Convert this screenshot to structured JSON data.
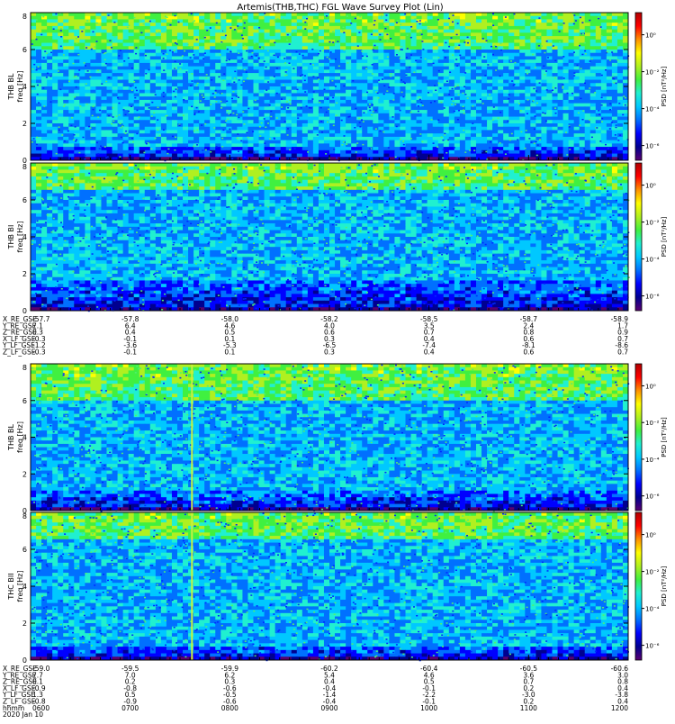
{
  "title": "Artemis(THB,THC) FGL Wave Survey Plot (Lin)",
  "chart_data": {
    "type": "heatmap",
    "title": "Artemis(THB,THC) FGL Wave Survey Plot (Lin)",
    "colormap": [
      "#5a0070",
      "#000090",
      "#0000ff",
      "#0070ff",
      "#00c8ff",
      "#20f0d0",
      "#40f040",
      "#b0f020",
      "#ffff00",
      "#ff9000",
      "#ff0000",
      "#b00000"
    ],
    "panels": [
      {
        "id": "p1",
        "ylabel_top": "THB BL",
        "ylabel": "freq [Hz]",
        "ylim": [
          0,
          8
        ],
        "yticks": [
          "0",
          "2",
          "4",
          "6",
          "8"
        ],
        "cbar_label": "PSD [nT²/Hz]",
        "cbar_ticks": [
          "10⁰",
          "10⁻²",
          "10⁻⁴",
          "10⁻⁶"
        ],
        "bright_band_hz": [
          6.0,
          8.0
        ],
        "noise_floor_hz": [
          0.0,
          0.8
        ],
        "spike_x_frac": null
      },
      {
        "id": "p2",
        "ylabel_top": "THB BI",
        "ylabel": "freq [Hz]",
        "ylim": [
          0,
          8
        ],
        "yticks": [
          "0",
          "2",
          "4",
          "6",
          "8"
        ],
        "cbar_label": "PSD [nT²/Hz]",
        "cbar_ticks": [
          "10⁰",
          "10⁻²",
          "10⁻⁴",
          "10⁻⁶"
        ],
        "bright_band_hz": [
          6.5,
          8.0
        ],
        "noise_floor_hz": [
          0.0,
          1.6
        ],
        "spike_x_frac": null
      },
      {
        "id": "p3",
        "ylabel_top": "THB BL",
        "ylabel": "freq [Hz]",
        "ylim": [
          0,
          8
        ],
        "yticks": [
          "0",
          "2",
          "4",
          "6",
          "8"
        ],
        "cbar_label": "PSD [nT²/Hz]",
        "cbar_ticks": [
          "10⁰",
          "10⁻²",
          "10⁻⁴",
          "10⁻⁶"
        ],
        "bright_band_hz": [
          6.0,
          8.0
        ],
        "noise_floor_hz": [
          0.0,
          1.0
        ],
        "spike_x_frac": 0.27
      },
      {
        "id": "p4",
        "ylabel_top": "THC BII",
        "ylabel": "freq [Hz]",
        "ylim": [
          0,
          8
        ],
        "yticks": [
          "0",
          "2",
          "4",
          "6",
          "8"
        ],
        "cbar_label": "PSD [nT²/Hz]",
        "cbar_ticks": [
          "10⁰",
          "10⁻²",
          "10⁻⁴",
          "10⁻⁶"
        ],
        "bright_band_hz": [
          6.5,
          8.0
        ],
        "noise_floor_hz": [
          0.0,
          0.8
        ],
        "spike_x_frac": 0.27
      }
    ],
    "ephemeris_top": {
      "rows": [
        {
          "label": "X_RE_GSE",
          "values": [
            "-57.7",
            "-57.8",
            "-58.0",
            "-58.2",
            "-58.5",
            "-58.7",
            "-58.9"
          ]
        },
        {
          "label": "Y_RE_GSE",
          "values": [
            "7.1",
            "6.4",
            "4.6",
            "4.0",
            "3.5",
            "2.4",
            "1.7"
          ]
        },
        {
          "label": "Z_RE_GSE",
          "values": [
            "0.3",
            "0.4",
            "0.5",
            "0.6",
            "0.7",
            "0.8",
            "0.9"
          ]
        },
        {
          "label": "X_LF_GSE",
          "values": [
            "-0.3",
            "-0.1",
            "0.1",
            "0.3",
            "0.4",
            "0.6",
            "0.7"
          ]
        },
        {
          "label": "Y_LF_GSE",
          "values": [
            "-1.2",
            "-3.6",
            "-5.3",
            "-6.5",
            "-7.4",
            "-8.1",
            "-8.6"
          ]
        },
        {
          "label": "Z_LF_GSE",
          "values": [
            "-0.3",
            "-0.1",
            "0.1",
            "0.3",
            "0.4",
            "0.6",
            "0.7"
          ]
        }
      ]
    },
    "ephemeris_bottom": {
      "rows": [
        {
          "label": "X_RE_GSE",
          "values": [
            "-59.0",
            "-59.5",
            "-59.9",
            "-60.2",
            "-60.4",
            "-60.5",
            "-60.6"
          ]
        },
        {
          "label": "Y_RE_GSE",
          "values": [
            "7.7",
            "7.0",
            "6.2",
            "5.4",
            "4.6",
            "3.6",
            "3.0"
          ]
        },
        {
          "label": "Z_RE_GSE",
          "values": [
            "0.1",
            "0.2",
            "0.3",
            "0.4",
            "0.5",
            "0.7",
            "0.8"
          ]
        },
        {
          "label": "X_LF_GSE",
          "values": [
            "-0.9",
            "-0.8",
            "-0.6",
            "-0.4",
            "-0.1",
            "0.2",
            "0.4"
          ]
        },
        {
          "label": "Y_LF_GSE",
          "values": [
            "1.3",
            "0.5",
            "-0.5",
            "-1.4",
            "-2.2",
            "-3.0",
            "-3.8"
          ]
        },
        {
          "label": "Z_LF_GSE",
          "values": [
            "-0.8",
            "-0.9",
            "-0.6",
            "-0.4",
            "-0.1",
            "0.2",
            "0.4"
          ]
        },
        {
          "label": "hhmm",
          "values": [
            "0600",
            "0700",
            "0800",
            "0900",
            "1000",
            "1100",
            "1200"
          ]
        }
      ],
      "date": "2020 Jan 10"
    }
  }
}
